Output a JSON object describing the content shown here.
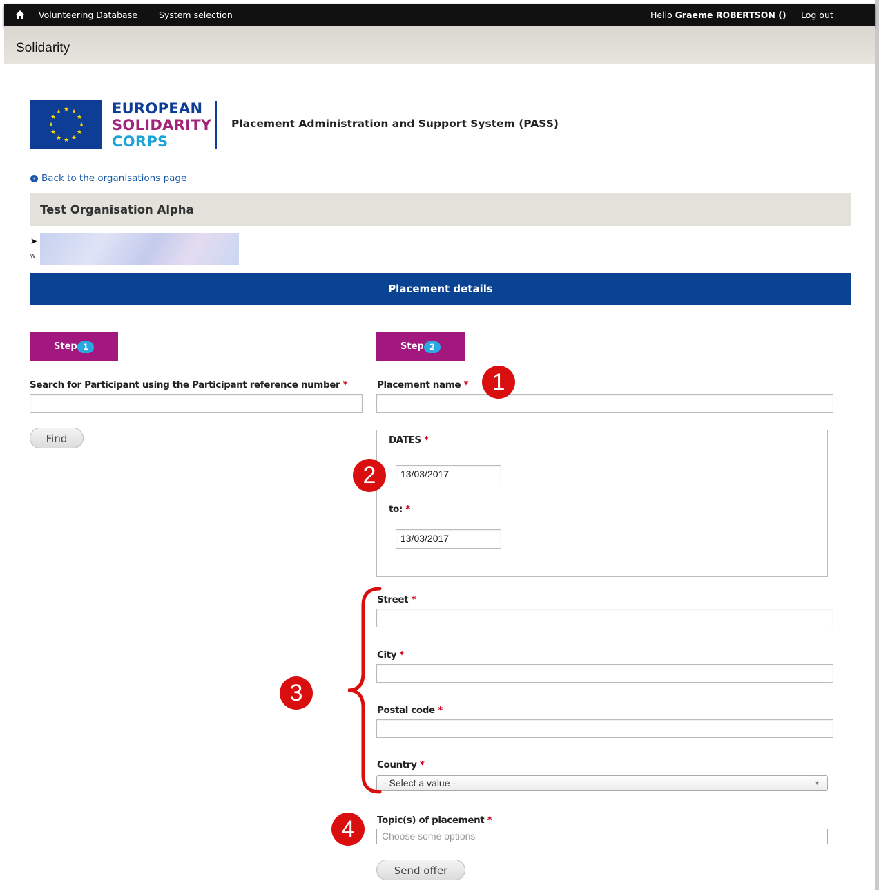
{
  "topbar": {
    "nav_db": "Volunteering Database",
    "nav_system": "System selection",
    "hello": "Hello",
    "user": "Graeme ROBERTSON ()",
    "logout": "Log out"
  },
  "site": {
    "name": "Solidarity"
  },
  "logo": {
    "line1": "EUROPEAN",
    "line2": "SOLIDARITY",
    "line3": "CORPS"
  },
  "system_title": "Placement Administration and Support System (PASS)",
  "back_link": "Back to the organisations page",
  "organisation": {
    "name": "Test Organisation Alpha",
    "ww_fragment": "w"
  },
  "section_title": "Placement details",
  "step1": {
    "label": "Step",
    "number": "1",
    "search_label": "Search for Participant using the Participant reference number",
    "search_value": "",
    "find_button": "Find"
  },
  "step2": {
    "label": "Step",
    "number": "2",
    "placement_name_label": "Placement name",
    "placement_name_value": "",
    "dates_label": "DATES",
    "date_from": "13/03/2017",
    "to_label": "to:",
    "date_to": "13/03/2017",
    "street_label": "Street",
    "city_label": "City",
    "postal_label": "Postal code",
    "country_label": "Country",
    "country_value": "- Select a value -",
    "topics_label": "Topic(s) of placement",
    "topics_placeholder": "Choose some options",
    "send_button": "Send offer"
  },
  "required_mark": "*",
  "annotations": [
    "1",
    "2",
    "3",
    "4"
  ],
  "colors": {
    "topbar": "#111111",
    "brand_blue": "#0b4393",
    "step_purple": "#a3187e",
    "step_badge": "#29a9e0",
    "annotation_red": "#d90e0e"
  }
}
